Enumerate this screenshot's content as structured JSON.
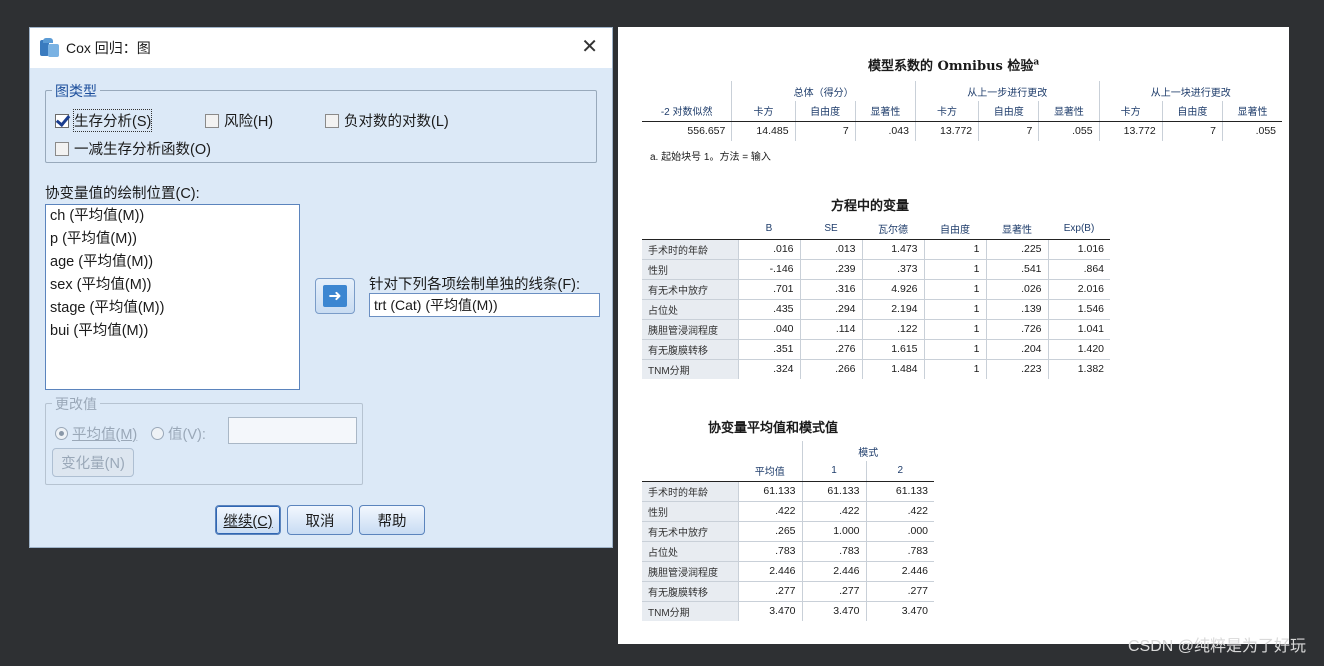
{
  "dialog": {
    "title": "Cox 回归：图",
    "close": "✕",
    "plot_type": {
      "legend": "图类型",
      "survival": "生存分析(S)",
      "hazard": "风险(H)",
      "log_minus_log": "负对数的对数(L)",
      "one_minus_survival": "一减生存分析函数(O)"
    },
    "covariate_label": "协变量值的绘制位置(C):",
    "covariates": [
      "ch (平均值(M))",
      "p (平均值(M))",
      "age (平均值(M))",
      "sex (平均值(M))",
      "stage (平均值(M))",
      "bui (平均值(M))"
    ],
    "separate_lines_label": "针对下列各项绘制单独的线条(F):",
    "separate_lines_value": "trt (Cat) (平均值(M))",
    "change_value": {
      "legend": "更改值",
      "mean": "平均值(M)",
      "value": "值(V):",
      "change_button": "变化量(N)"
    },
    "buttons": {
      "continue": "继续(C)",
      "cancel": "取消",
      "help": "帮助"
    }
  },
  "output": {
    "omnibus": {
      "title": "模型系数的 Omnibus 检验",
      "title_sup": "a",
      "group_headers": [
        "总体（得分）",
        "从上一步进行更改",
        "从上一块进行更改"
      ],
      "col_headers": [
        "-2 对数似然",
        "卡方",
        "自由度",
        "显著性",
        "卡方",
        "自由度",
        "显著性",
        "卡方",
        "自由度",
        "显著性"
      ],
      "row": [
        "556.657",
        "14.485",
        "7",
        ".043",
        "13.772",
        "7",
        ".055",
        "13.772",
        "7",
        ".055"
      ],
      "footnote": "a. 起始块号 1。方法 = 输入"
    },
    "variables": {
      "title": "方程中的变量",
      "col_headers": [
        "B",
        "SE",
        "瓦尔德",
        "自由度",
        "显著性",
        "Exp(B)"
      ],
      "rows": [
        {
          "name": "手术时的年龄",
          "vals": [
            ".016",
            ".013",
            "1.473",
            "1",
            ".225",
            "1.016"
          ]
        },
        {
          "name": "性别",
          "vals": [
            "-.146",
            ".239",
            ".373",
            "1",
            ".541",
            ".864"
          ]
        },
        {
          "name": "有无术中放疗",
          "vals": [
            ".701",
            ".316",
            "4.926",
            "1",
            ".026",
            "2.016"
          ]
        },
        {
          "name": "占位处",
          "vals": [
            ".435",
            ".294",
            "2.194",
            "1",
            ".139",
            "1.546"
          ]
        },
        {
          "name": "胰胆管浸润程度",
          "vals": [
            ".040",
            ".114",
            ".122",
            "1",
            ".726",
            "1.041"
          ]
        },
        {
          "name": "有无腹膜转移",
          "vals": [
            ".351",
            ".276",
            "1.615",
            "1",
            ".204",
            "1.420"
          ]
        },
        {
          "name": "TNM分期",
          "vals": [
            ".324",
            ".266",
            "1.484",
            "1",
            ".223",
            "1.382"
          ]
        }
      ]
    },
    "means": {
      "title": "协变量平均值和模式值",
      "group_header": "模式",
      "col_headers": [
        "平均值",
        "1",
        "2"
      ],
      "rows": [
        {
          "name": "手术时的年龄",
          "vals": [
            "61.133",
            "61.133",
            "61.133"
          ]
        },
        {
          "name": "性别",
          "vals": [
            ".422",
            ".422",
            ".422"
          ]
        },
        {
          "name": "有无术中放疗",
          "vals": [
            ".265",
            "1.000",
            ".000"
          ]
        },
        {
          "name": "占位处",
          "vals": [
            ".783",
            ".783",
            ".783"
          ]
        },
        {
          "name": "胰胆管浸润程度",
          "vals": [
            "2.446",
            "2.446",
            "2.446"
          ]
        },
        {
          "name": "有无腹膜转移",
          "vals": [
            ".277",
            ".277",
            ".277"
          ]
        },
        {
          "name": "TNM分期",
          "vals": [
            "3.470",
            "3.470",
            "3.470"
          ]
        }
      ]
    }
  },
  "watermark": "CSDN @纯粹是为了好玩"
}
